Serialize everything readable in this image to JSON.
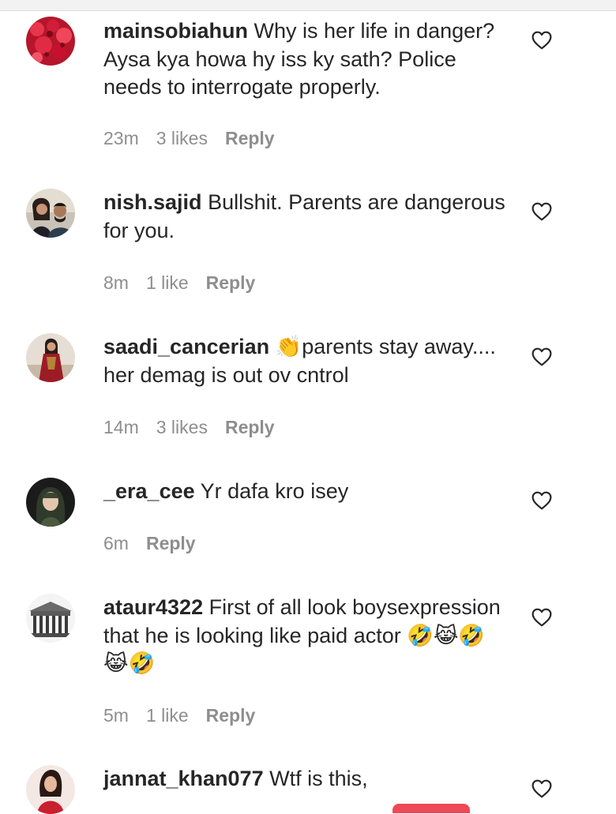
{
  "comments": [
    {
      "username": "mainsobiahun",
      "text": "Why is her life in danger? Aysa kya howa hy iss ky sath? Police needs to interrogate properly.",
      "time": "23m",
      "likes": "3 likes",
      "reply": "Reply",
      "avatar": "flowers-avatar"
    },
    {
      "username": "nish.sajid",
      "text": "Bullshit. Parents are dangerous for you.",
      "time": "8m",
      "likes": "1 like",
      "reply": "Reply",
      "avatar": "couple-avatar"
    },
    {
      "username": "saadi_cancerian",
      "text": "👏parents stay away.... her demag is out ov cntrol",
      "time": "14m",
      "likes": "3 likes",
      "reply": "Reply",
      "avatar": "woman-red-dress-avatar"
    },
    {
      "username": "_era_cee",
      "text": "Yr dafa kro isey",
      "time": "6m",
      "likes": "",
      "reply": "Reply",
      "avatar": "woman-hijab-avatar"
    },
    {
      "username": "ataur4322",
      "text": "First of all look boysexpression that he is looking like paid actor 🤣😹🤣😹🤣",
      "time": "5m",
      "likes": "1 like",
      "reply": "Reply",
      "avatar": "building-avatar"
    },
    {
      "username": "jannat_khan077",
      "text": "Wtf is this,",
      "time": "",
      "likes": "",
      "reply": "",
      "avatar": "woman-red-avatar"
    }
  ],
  "colors": {
    "text": "#262626",
    "meta": "#8e8e8e",
    "accent": "#ed4956"
  },
  "icons": {
    "like": "heart-outline-icon"
  }
}
